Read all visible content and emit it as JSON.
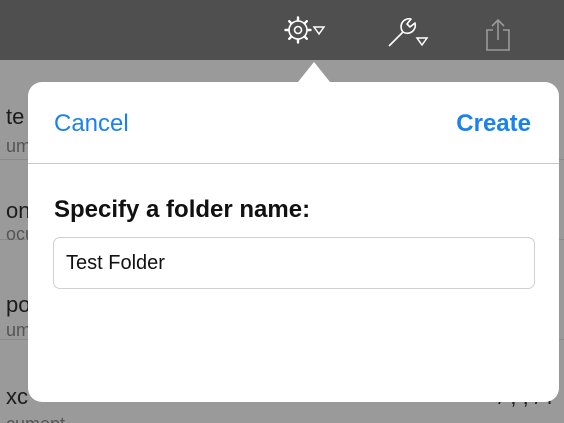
{
  "toolbar": {
    "icons": [
      "gear-icon",
      "wrench-icon",
      "share-icon"
    ]
  },
  "background_list": {
    "rows": [
      {
        "title": "te",
        "subtitle": "um"
      },
      {
        "title": "on",
        "subtitle": "ocu"
      },
      {
        "title": "po",
        "subtitle": "um"
      },
      {
        "title": "xc",
        "subtitle": "cument",
        "meta": "/ , , /  l"
      }
    ]
  },
  "popover": {
    "cancel_label": "Cancel",
    "create_label": "Create",
    "prompt": "Specify a folder name:",
    "folder_name_value": "Test Folder"
  },
  "colors": {
    "accent": "#1a82f0",
    "toolbar_bg": "#4f4f4f"
  }
}
